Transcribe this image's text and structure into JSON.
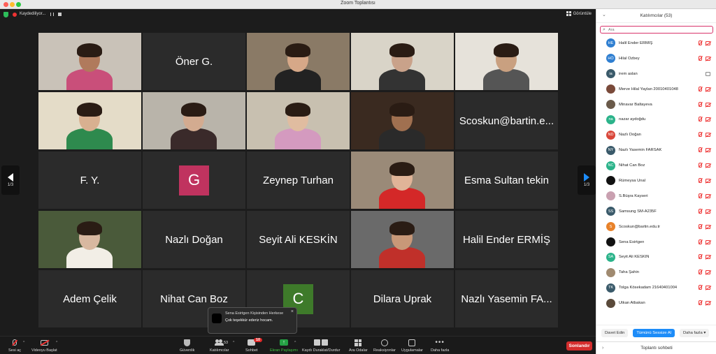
{
  "window": {
    "title": "Zoom Toplantısı"
  },
  "topbar": {
    "recording_label": "Kaydediliyor...",
    "view_label": "Görüntüle"
  },
  "tiles": [
    {
      "type": "photo",
      "name": "",
      "bg": "#c9c2b8",
      "skin": "#b07a5c",
      "shirt": "#c94f7a"
    },
    {
      "type": "name",
      "name": "Öner G."
    },
    {
      "type": "photo",
      "name": "",
      "bg": "#8a7a66",
      "skin": "#d6a888",
      "shirt": "#222222"
    },
    {
      "type": "photo",
      "name": "",
      "bg": "#d9d4c8",
      "skin": "#c9a28a",
      "shirt": "#333333"
    },
    {
      "type": "photo",
      "name": "",
      "bg": "#e6e2da",
      "skin": "#c9a080",
      "shirt": "#555555",
      "active": true
    },
    {
      "type": "photo",
      "name": "",
      "bg": "#e4dcc8",
      "skin": "#d8b090",
      "shirt": "#2e8a4e"
    },
    {
      "type": "photo",
      "name": "",
      "bg": "#b9b4aa",
      "skin": "#d3ab90",
      "shirt": "#3a2a2a"
    },
    {
      "type": "photo",
      "name": "",
      "bg": "#c8c0b0",
      "skin": "#e0bca0",
      "shirt": "#d49abf"
    },
    {
      "type": "photo",
      "name": "",
      "bg": "#3a2a20",
      "skin": "#a07050",
      "shirt": "#2a2a2a"
    },
    {
      "type": "name",
      "name": "Scoskun@bartin.e..."
    },
    {
      "type": "name",
      "name": "F. Y."
    },
    {
      "type": "letter",
      "letter": "G",
      "color": "#c0335f"
    },
    {
      "type": "name",
      "name": "Zeynep Turhan"
    },
    {
      "type": "photo",
      "name": "",
      "bg": "#9a8a78",
      "skin": "#e0b498",
      "shirt": "#d42828"
    },
    {
      "type": "name",
      "name": "Esma Sultan tekin"
    },
    {
      "type": "photo",
      "name": "",
      "bg": "#4a5a3a",
      "skin": "#d8b8a0",
      "shirt": "#f2eee6"
    },
    {
      "type": "name",
      "name": "Nazlı Doğan"
    },
    {
      "type": "name",
      "name": "Seyit Ali KESKİN"
    },
    {
      "type": "photo",
      "name": "",
      "bg": "#6a6a6a",
      "skin": "#c89878",
      "shirt": "#c0302a"
    },
    {
      "type": "name",
      "name": "Halil Ender ERMİŞ"
    },
    {
      "type": "name",
      "name": "Adem Çelik"
    },
    {
      "type": "name",
      "name": "Nihat Can Boz"
    },
    {
      "type": "letter",
      "letter": "C",
      "color": "#3e7a2a"
    },
    {
      "type": "name",
      "name": "Dilara Uprak"
    },
    {
      "type": "name",
      "name": "Nazlı Yasemin FA..."
    }
  ],
  "pager": {
    "left": "1/3",
    "right": "1/3"
  },
  "chat_popup": {
    "from": "Sena Esirtgen Kişisinden Herkese",
    "message": "Çok teşekkür ederiz hocam.",
    "close": "×"
  },
  "toolbar": {
    "mute": "Sesi aç",
    "video": "Videoyu Başlat",
    "security": "Güvenlik",
    "participants": "Katılımcılar",
    "participants_count": "53",
    "chat": "Sohbet",
    "chat_badge": "10",
    "share": "Ekran Paylaşımı",
    "record": "Kaydı Duraklat/Durdur",
    "rooms": "Ara Odalar",
    "reactions": "Reaksiyonlar",
    "apps": "Uygulamalar",
    "more": "Daha fazla",
    "end": "Sonlandır"
  },
  "panel": {
    "title": "Katılımcılar (53)",
    "search_placeholder": "Ara",
    "participants": [
      {
        "name": "Halil Ender ERMİŞ",
        "initials": "HE",
        "color": "#2f7fd1",
        "cam": "off"
      },
      {
        "name": "Hilal Özbey",
        "initials": "HÖ",
        "color": "#2f7fd1",
        "cam": "off"
      },
      {
        "name": "irem aslan",
        "initials": "ia",
        "color": "#3a5a6a",
        "cam": "on"
      },
      {
        "name": "Merve Hilal Yaylan 20010401048",
        "initials": "",
        "color": "#7a4a3a",
        "cam": "off"
      },
      {
        "name": "Minavar Baltayeva",
        "initials": "",
        "color": "#6a5a4a",
        "cam": "off"
      },
      {
        "name": "nazar aydoğdu",
        "initials": "na",
        "color": "#2bb38a",
        "cam": "off"
      },
      {
        "name": "Nazlı Doğan",
        "initials": "ND",
        "color": "#d9473a",
        "cam": "off"
      },
      {
        "name": "Nazlı Yasemin FARSAK",
        "initials": "NY",
        "color": "#3a5a6a",
        "cam": "off"
      },
      {
        "name": "Nihat Can Boz",
        "initials": "NC",
        "color": "#2bb38a",
        "cam": "off"
      },
      {
        "name": "Rümeysa Ünal",
        "initials": "",
        "color": "#111111",
        "cam": "off"
      },
      {
        "name": "S.Büşra Kayseri",
        "initials": "",
        "color": "#c9a0b0",
        "cam": "off"
      },
      {
        "name": "Samsung SM-A235F",
        "initials": "SS",
        "color": "#3a5a6a",
        "cam": "off"
      },
      {
        "name": "Scoskun@bartin.edu.tr",
        "initials": "S",
        "color": "#e8822a",
        "cam": "off"
      },
      {
        "name": "Sena Esirtgen",
        "initials": "",
        "color": "#111111",
        "cam": "off"
      },
      {
        "name": "Seyit Ali KESKİN",
        "initials": "SA",
        "color": "#2bb38a",
        "cam": "off"
      },
      {
        "name": "Taha Şahin",
        "initials": "",
        "color": "#a08a70",
        "cam": "off"
      },
      {
        "name": "Tolga Kösekadam 21640401004",
        "initials": "TK",
        "color": "#3a5a6a",
        "cam": "off"
      },
      {
        "name": "Utkan Atbakan",
        "initials": "",
        "color": "#5a4a3a",
        "cam": "off"
      }
    ],
    "invite": "Davet Edin",
    "mute_all": "Tümünü Sessize Al",
    "more": "Daha fazla",
    "chat_title": "Toplantı sohbeti"
  }
}
